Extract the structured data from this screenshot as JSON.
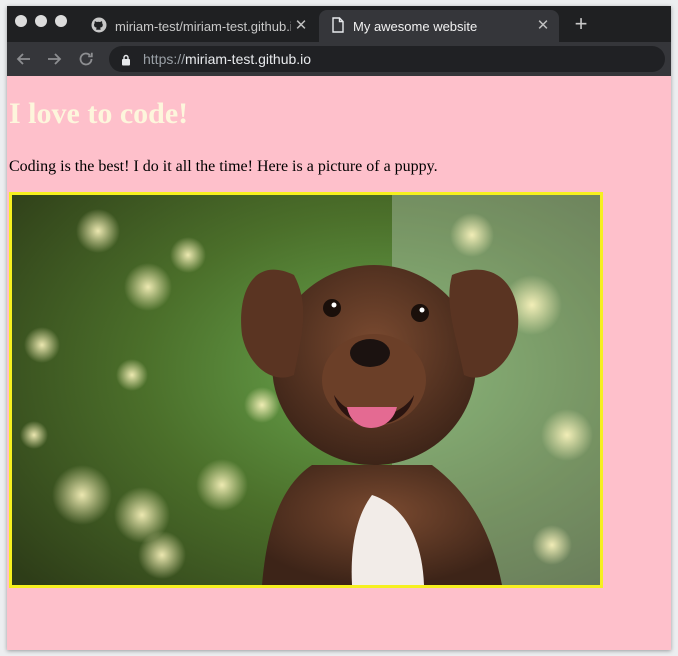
{
  "browser": {
    "tabs": [
      {
        "title": "miriam-test/miriam-test.github.io",
        "icon": "github-icon",
        "active": false
      },
      {
        "title": "My awesome website",
        "icon": "document-icon",
        "active": true
      }
    ],
    "new_tab_label": "+",
    "close_label": "✕",
    "url_prefix": "https://",
    "url_host": "miriam-test.github.io"
  },
  "page": {
    "heading": "I love to code!",
    "paragraph": "Coding is the best! I do it all the time! Here is a picture of a puppy.",
    "image_description": "puppy photo",
    "border_color": "#f6f01f",
    "background_color": "#fec0cb",
    "heading_color": "#fdf6dc"
  }
}
